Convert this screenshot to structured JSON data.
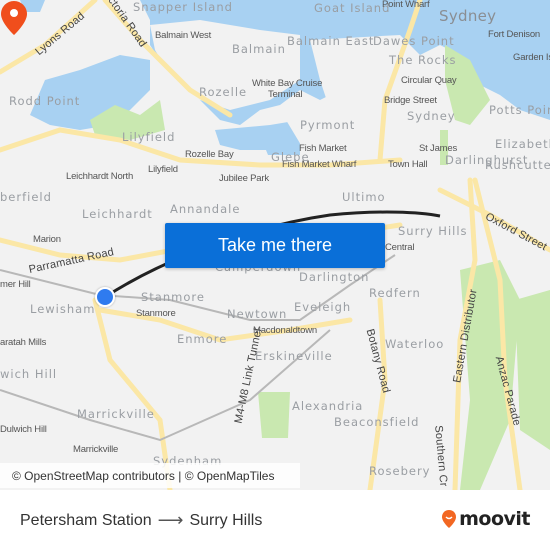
{
  "map": {
    "labels": {
      "snapper_island": "Snapper Island",
      "goat_island": "Goat Island",
      "point_wharf": "Point Wharf",
      "sydney_city": "Sydney",
      "lyons_road": "Lyons Road",
      "victoria_road": "Victoria Road",
      "balmain_west": "Balmain West",
      "balmain": "Balmain",
      "balmain_east": "Balmain East",
      "dawes_point": "Dawes Point",
      "fort_denison": "Fort Denison",
      "garden_island": "Garden Island",
      "the_rocks": "The Rocks",
      "circular_quay": "Circular Quay",
      "white_bay": "White Bay Cruise",
      "white_bay_2": "Terminal",
      "rodd_point": "Rodd Point",
      "rozelle": "Rozelle",
      "bridge_street": "Bridge Street",
      "sydney_cbd": "Sydney",
      "potts_point": "Potts Point",
      "pyrmont": "Pyrmont",
      "lilyfield": "Lilyfield",
      "lilyfield_stop": "Lilyfield",
      "elizabeth": "Elizabeth",
      "fish_market": "Fish Market",
      "st_james": "St James",
      "rozelle_bay": "Rozelle Bay",
      "fish_market_wharf": "Fish Market Wharf",
      "town_hall": "Town Hall",
      "rushcutters": "Rushcutters",
      "leichhardt_north": "Leichhardt North",
      "jubilee_park": "Jubilee Park",
      "glebe": "Glebe",
      "darlinghurst": "Darlinghurst",
      "haberfield": "berfield",
      "ultimo": "Ultimo",
      "leichhardt": "Leichhardt",
      "annandale": "Annandale",
      "oxford_street": "Oxford Street",
      "surry_hills": "Surry Hills",
      "marion": "Marion",
      "central": "Central",
      "parramatta_road": "Parramatta Road",
      "camperdown": "Camperdown",
      "darlington": "Darlington",
      "summer_hill": "mer Hill",
      "stanmore": "Stanmore",
      "stanmore_stop": "Stanmore",
      "redfern": "Redfern",
      "lewisham": "Lewisham",
      "eveleigh": "Eveleigh",
      "newtown": "Newtown",
      "macdonaldtown": "Macdonaldtown",
      "eastern_distributor": "Eastern Distributor",
      "enmore": "Enmore",
      "waratah_mills": "aratah Mills",
      "botany_road": "Botany Road",
      "waterloo": "Waterloo",
      "anzac_parade": "Anzac Parade",
      "erskineville": "Erskineville",
      "dulwich_hill": "wich Hill",
      "m4m8": "M4-M8 Link Tunnel",
      "marrickville": "Marrickville",
      "alexandria": "Alexandria",
      "beaconsfield": "Beaconsfield",
      "dulwich_hill_stop": "Dulwich Hill",
      "southern_cross": "Southern Cr",
      "marrickville_stop": "Marrickville",
      "sydenham": "Sydenham",
      "rosebery": "Rosebery"
    },
    "cta_label": "Take me there",
    "attribution": "© OpenStreetMap contributors | © OpenMapTiles",
    "colors": {
      "water": "#a8d1f2",
      "park": "#c9e8b0",
      "road": "#fbe7a6",
      "land": "#f2f2f2",
      "route": "#222222",
      "origin": "#2f7bef",
      "destination": "#f04e1c",
      "cta": "#0a6fd8"
    }
  },
  "footer": {
    "origin": "Petersham Station",
    "arrow": "⟶",
    "destination": "Surry Hills",
    "brand": "moovit",
    "brand_color": "#f26722"
  }
}
